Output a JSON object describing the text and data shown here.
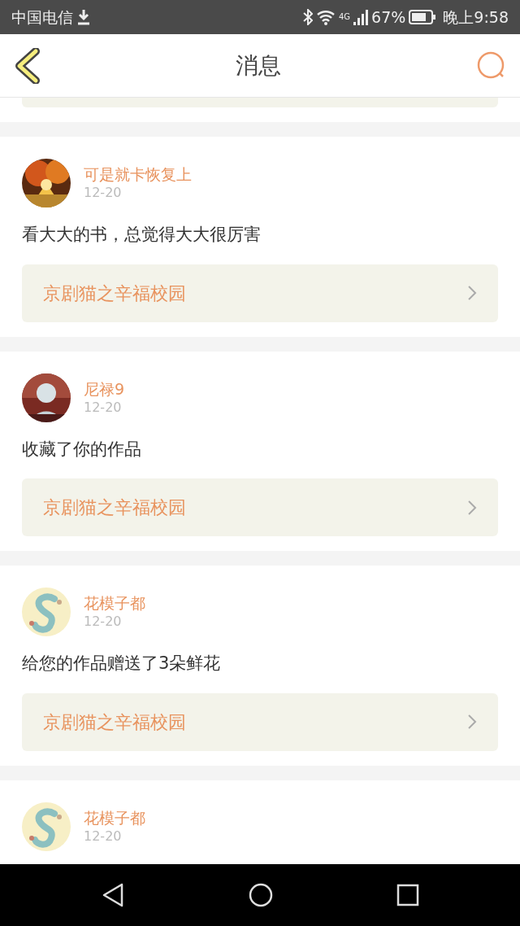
{
  "status_bar": {
    "carrier": "中国电信",
    "network": "4G",
    "battery": "67%",
    "time": "晚上9:58"
  },
  "header": {
    "title": "消息"
  },
  "messages": [
    {
      "name": "可是就卡恢复上",
      "date": "12-20",
      "text": "看大大的书，总觉得大大很厉害",
      "work": "京剧猫之辛福校园"
    },
    {
      "name": "尼禄9",
      "date": "12-20",
      "text": "收藏了你的作品",
      "work": "京剧猫之辛福校园"
    },
    {
      "name": "花模子都",
      "date": "12-20",
      "text": "给您的作品赠送了3朵鲜花",
      "work": "京剧猫之辛福校园"
    },
    {
      "name": "花模子都",
      "date": "12-20"
    }
  ]
}
